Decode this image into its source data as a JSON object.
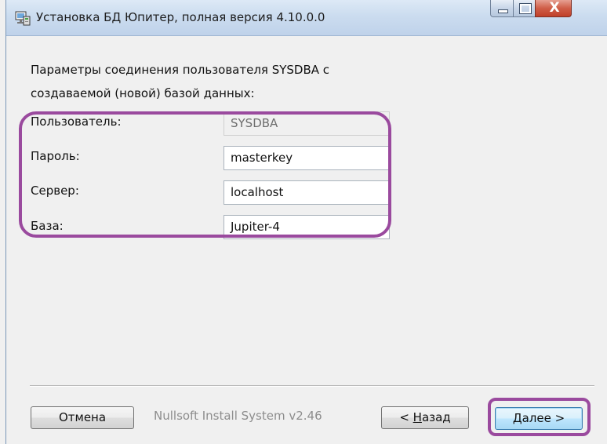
{
  "window": {
    "title": "Установка БД Юпитер, полная версия 4.10.0.0",
    "app_icon": "installer-icon",
    "controls": {
      "minimize": "minimize-icon",
      "maximize": "maximize-icon",
      "close": "close-icon",
      "close_glyph": "X"
    }
  },
  "content": {
    "description_line1": "Параметры соединения пользователя SYSDBA с",
    "description_line2": "создаваемой (новой) базой данных:",
    "fields": [
      {
        "label": "Пользователь:",
        "value": "SYSDBA",
        "enabled": false
      },
      {
        "label": "Пароль:",
        "value": "masterkey",
        "enabled": true
      },
      {
        "label": "Сервер:",
        "value": "localhost",
        "enabled": true
      },
      {
        "label": "База:",
        "value": "Jupiter-4",
        "enabled": true
      }
    ]
  },
  "footer": {
    "cancel_label": "Отмена",
    "branding": "Nullsoft Install System v2.46",
    "back_prefix": "< ",
    "back_hotkey": "Н",
    "back_rest": "азад",
    "next_hotkey": "Д",
    "next_rest": "алее >"
  },
  "colors": {
    "highlight": "#9a4a9e",
    "titlebar": "#cbdcef",
    "close_button": "#c03f28",
    "background": "#f0f0f0"
  }
}
